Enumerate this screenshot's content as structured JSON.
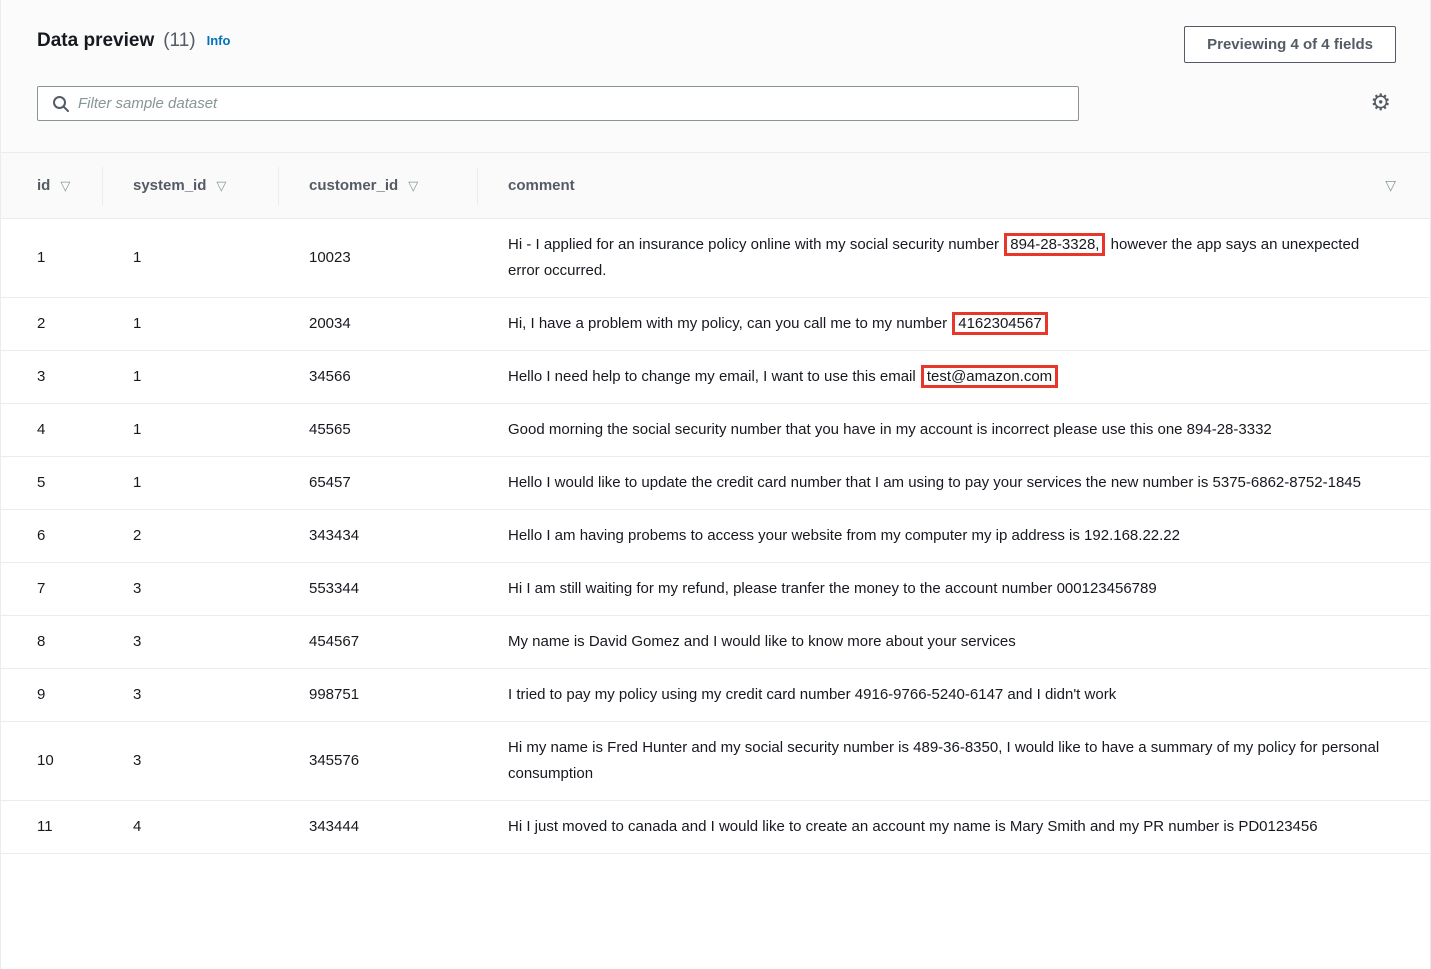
{
  "panel": {
    "title": "Data preview",
    "count": "(11)",
    "info_label": "Info",
    "preview_button_label": "Previewing 4 of 4 fields",
    "filter_placeholder": "Filter sample dataset",
    "filter_value": ""
  },
  "icons": {
    "sort_glyph": "▽",
    "gear_glyph": "⚙",
    "search": "search-icon"
  },
  "colors": {
    "highlight_border": "#e8362a",
    "link_blue": "#0073bb",
    "header_text": "#545b64",
    "row_divider": "#eaeded"
  },
  "table": {
    "columns": [
      {
        "label": "id",
        "sortable": true
      },
      {
        "label": "system_id",
        "sortable": true
      },
      {
        "label": "customer_id",
        "sortable": true
      },
      {
        "label": "comment",
        "sortable": false
      }
    ],
    "rows": [
      {
        "id": "1",
        "system_id": "1",
        "customer_id": "10023",
        "comment_before": "Hi - I applied for an insurance policy online with my social security number ",
        "comment_highlight": "894-28-3328,",
        "comment_after": " however the app says an unexpected error occurred."
      },
      {
        "id": "2",
        "system_id": "1",
        "customer_id": "20034",
        "comment_before": "Hi, I have a problem with my policy, can you call me to my number ",
        "comment_highlight": "4162304567",
        "comment_after": ""
      },
      {
        "id": "3",
        "system_id": "1",
        "customer_id": "34566",
        "comment_before": "Hello I need help to change my email, I want to use this email ",
        "comment_highlight": "test@amazon.com",
        "comment_after": ""
      },
      {
        "id": "4",
        "system_id": "1",
        "customer_id": "45565",
        "comment_before": "Good morning the social security number that you have in my account is incorrect please use this one 894-28-3332",
        "comment_highlight": "",
        "comment_after": ""
      },
      {
        "id": "5",
        "system_id": "1",
        "customer_id": "65457",
        "comment_before": "Hello I would like to update the credit card number that I am using to pay your services the new number is 5375-6862-8752-1845",
        "comment_highlight": "",
        "comment_after": ""
      },
      {
        "id": "6",
        "system_id": "2",
        "customer_id": "343434",
        "comment_before": "Hello I am having probems to access your website from my computer my ip address is 192.168.22.22",
        "comment_highlight": "",
        "comment_after": ""
      },
      {
        "id": "7",
        "system_id": "3",
        "customer_id": "553344",
        "comment_before": "Hi I am still waiting for my refund, please tranfer the money to the account number 000123456789",
        "comment_highlight": "",
        "comment_after": ""
      },
      {
        "id": "8",
        "system_id": "3",
        "customer_id": "454567",
        "comment_before": "My name is David Gomez and I would like to know more about your services",
        "comment_highlight": "",
        "comment_after": ""
      },
      {
        "id": "9",
        "system_id": "3",
        "customer_id": "998751",
        "comment_before": "I tried to pay my policy using my credit card number 4916-9766-5240-6147 and I didn't work",
        "comment_highlight": "",
        "comment_after": ""
      },
      {
        "id": "10",
        "system_id": "3",
        "customer_id": "345576",
        "comment_before": "Hi my name is Fred Hunter and my social security number is 489-36-8350, I would like to have a summary of my policy for personal consumption",
        "comment_highlight": "",
        "comment_after": ""
      },
      {
        "id": "11",
        "system_id": "4",
        "customer_id": "343444",
        "comment_before": "Hi I just moved to canada and I would like to create an account my name is Mary Smith and my PR number is PD0123456",
        "comment_highlight": "",
        "comment_after": ""
      }
    ]
  }
}
